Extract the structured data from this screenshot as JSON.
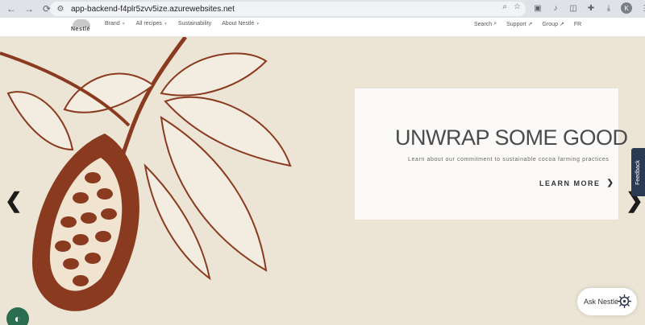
{
  "browser": {
    "url": "app-backend-f4plr5zvv5ize.azurewebsites.net",
    "back_icon": "arrow-left-icon",
    "forward_icon": "arrow-right-icon",
    "reload_icon": "reload-icon",
    "profile_initial": "K"
  },
  "header": {
    "logo_text": "Nestlé",
    "nav": [
      {
        "label": "Brand"
      },
      {
        "label": "All recipes"
      },
      {
        "label": "Sustainability"
      },
      {
        "label": "About Nestlé"
      }
    ],
    "utility": [
      {
        "label": "Search"
      },
      {
        "label": "Support"
      },
      {
        "label": "Group"
      },
      {
        "label": "FR"
      }
    ]
  },
  "hero": {
    "title": "UNWRAP SOME GOOD",
    "subtitle": "Learn about our commitment to sustainable cocoa farming practices",
    "cta_label": "LEARN MORE",
    "prev_label": "❮",
    "next_label": "❯"
  },
  "widgets": {
    "feedback_label": "Feedback",
    "ask_label": "Ask Nestlé"
  },
  "colors": {
    "hero_bg": "#ece5d6",
    "cocoa_ink": "#8a3a1e",
    "feedback_bg": "#2b3a53",
    "cookie_bg": "#2b6e4f"
  }
}
